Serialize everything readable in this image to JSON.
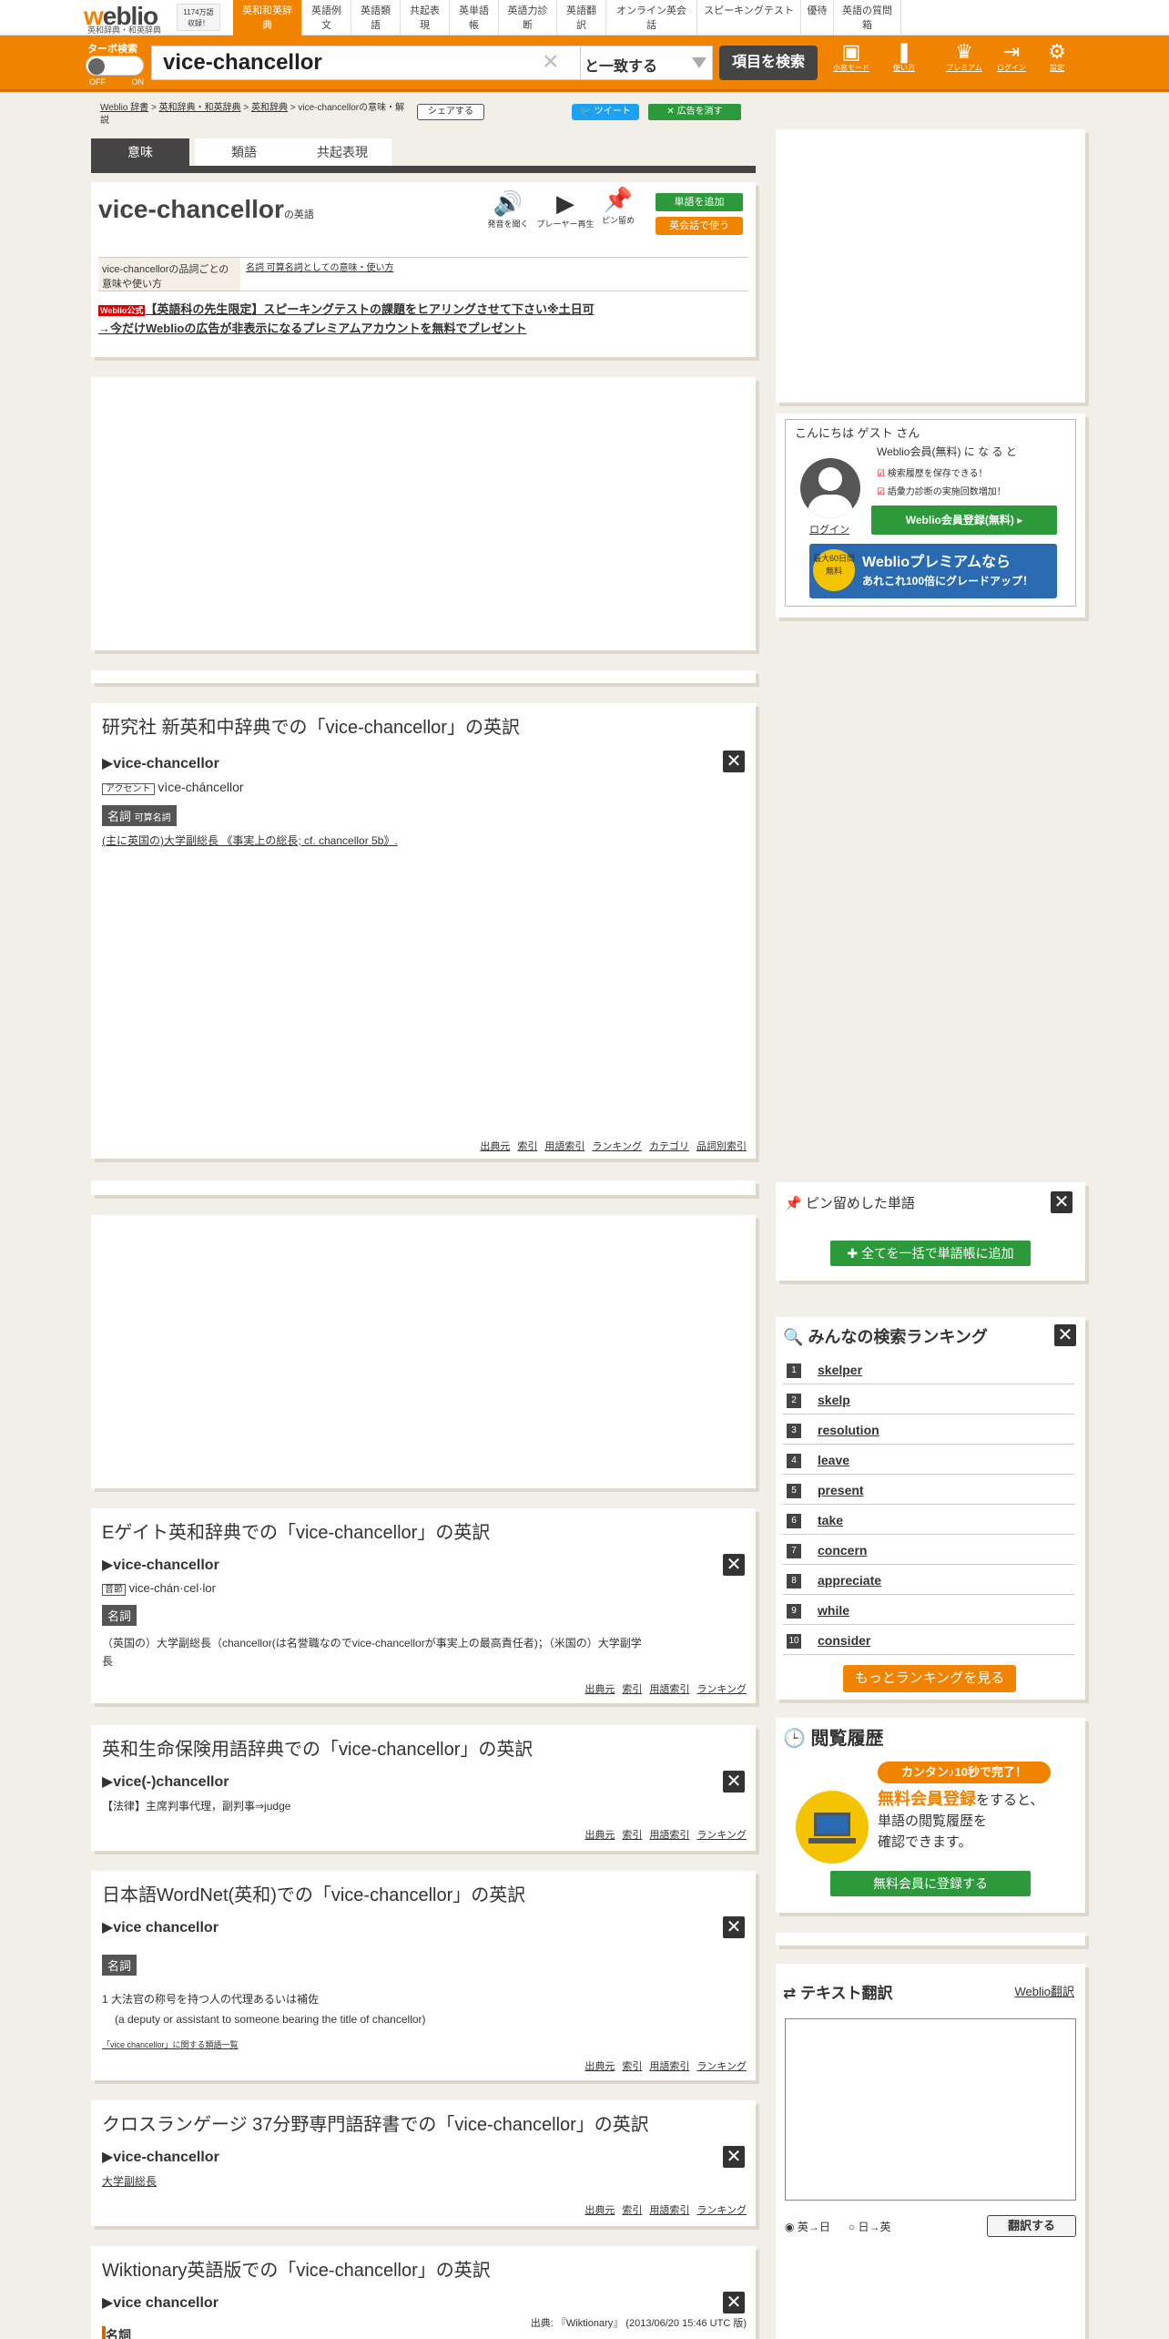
{
  "header": {
    "logo_w": "w",
    "logo_rest": "eblio",
    "logo_sub": "英和辞典・和英辞典",
    "badge_line1": "1174万語",
    "badge_line2": "収録！",
    "tabs": [
      "英和和英辞典",
      "英語例文",
      "英語類語",
      "共起表現",
      "英単語帳",
      "英語力診断",
      "英語翻訳",
      "オンライン英会話",
      "スピーキングテスト",
      "優待",
      "英語の質問箱"
    ],
    "turbo": "ターボ検索",
    "off": "OFF",
    "on": "ON",
    "query": "vice-chancellor",
    "clear": "×",
    "match": "と一致する",
    "search_button": "項目を検索",
    "icons": [
      {
        "name": "small-mode-icon",
        "label": "小窓モード",
        "glyph": "▣"
      },
      {
        "name": "usage-icon",
        "label": "使い方",
        "glyph": "❚"
      },
      {
        "name": "premium-icon",
        "label": "プレミアム",
        "glyph": "♛"
      },
      {
        "name": "login-icon",
        "label": "ログイン",
        "glyph": "⇥"
      },
      {
        "name": "settings-icon",
        "label": "設定",
        "glyph": "⚙"
      }
    ]
  },
  "crumb": {
    "a": "Weblio 辞書",
    "b": "英和辞典・和英辞典",
    "c": "英和辞典",
    "tail": "vice-chancellorの意味・解説",
    "sep": " > "
  },
  "share": "シェアする",
  "tweet": "ツイート",
  "adoff": "広告を消す",
  "subtabs": [
    "意味",
    "類語",
    "共起表現"
  ],
  "word_card": {
    "word": "vice-chancellor",
    "suffix": "の英語",
    "listen": "発音を聞く",
    "player": "プレーヤー再生",
    "pin": "ピン留め",
    "add": "単語を追加",
    "conv": "英会話で使う",
    "table_left": "vice-chancellorの品詞ごとの意味や使い方",
    "table_right": "名詞 可算名詞としての意味・使い方",
    "promo_badge": "Weblio公式",
    "promo1": "【英語科の先生限定】スピーキングテストの課題をヒアリングさせて下さい※土日可",
    "promo2": "→今だけWeblioの広告が非表示になるプレミアムアカウントを無料でプレゼント"
  },
  "kenkyusha": {
    "title": "研究社 新英和中辞典での「vice-chancellor」の英訳",
    "head": "▶vice-chancellor",
    "accent_label": "アクセント",
    "accent": "vìce-cháncellor",
    "pos": "名詞",
    "pos_sub": "可算名詞",
    "def": "(主に英国の)大学副総長 《事実上の総長; cf. chancellor 5b》."
  },
  "foot1": [
    "出典元",
    "索引",
    "用語索引",
    "ランキング",
    "カテゴリ",
    "品詞別索引"
  ],
  "foot2": [
    "出典元",
    "索引",
    "用語索引",
    "ランキング"
  ],
  "egate": {
    "title": "Eゲイト英和辞典での「vice-chancellor」の英訳",
    "head": "▶vice-chancellor",
    "pron_label": "音節",
    "pron": "vice-chán·cel·lor",
    "pos": "名詞",
    "def1": "（英国の）大学副総長（chancellor(は名誉職なのでvice-chancellorが事実上の最高責任者)；（米国の）大学副学",
    "def2": "長"
  },
  "hoken": {
    "title": "英和生命保険用語辞典での「vice-chancellor」の英訳",
    "head": "▶vice(-)chancellor",
    "def": "【法律】主席判事代理，副判事⇒judge"
  },
  "wordnet": {
    "title": "日本語WordNet(英和)での「vice-chancellor」の英訳",
    "head": "▶vice chancellor",
    "pos": "名詞",
    "def1": "1  大法官の称号を持つ人の代理あるいは補佐",
    "def2": "(a deputy or assistant to someone bearing the title of chancellor)",
    "rel": "「vice chancellor」に関する類語一覧"
  },
  "cross": {
    "title": "クロスランゲージ 37分野専門語辞書での「vice-chancellor」の英訳",
    "head": "▶vice-chancellor",
    "def": "大学副総長"
  },
  "wiki": {
    "title": "Wiktionary英語版での「vice-chancellor」の英訳",
    "head": "▶vice chancellor",
    "source": "出典: 『Wiktionary』 (2013/06/20 15:46 UTC 版)",
    "pos": "名詞"
  },
  "welcome": {
    "greeting": "こんにちは ゲスト さん",
    "member": "Weblio会員(無料) に な る と",
    "b1": "検索履歴を保存できる！",
    "b2": "語彙力診断の実施回数増加！",
    "login": "ログイン",
    "reg": "Weblio会員登録(無料)",
    "prem1": "Weblioプレミアムなら",
    "prem2": "あれこれ100倍にグレードアップ！",
    "prem_badge": "最大60日間無料"
  },
  "pinned": {
    "title": "ピン留めした単語",
    "add_all": "全てを一括で単語帳に追加"
  },
  "ranking": {
    "title": "みんなの検索ランキング",
    "words": [
      "skelper",
      "skelp",
      "resolution",
      "leave",
      "present",
      "take",
      "concern",
      "appreciate",
      "while",
      "consider"
    ],
    "more": "もっとランキングを見る"
  },
  "history": {
    "title": "閲覧履歴",
    "pill": "カンタン♪10秒で完了！",
    "l1a": "無料会員登録",
    "l1b": "をすると、",
    "l2": "単語の閲覧履歴を",
    "l3": "確認できます。",
    "btn": "無料会員に登録する"
  },
  "translate": {
    "title": "テキスト翻訳",
    "weblio": "Weblio翻訳",
    "r1": "英→日",
    "r2": "日→英",
    "btn": "翻訳する"
  }
}
